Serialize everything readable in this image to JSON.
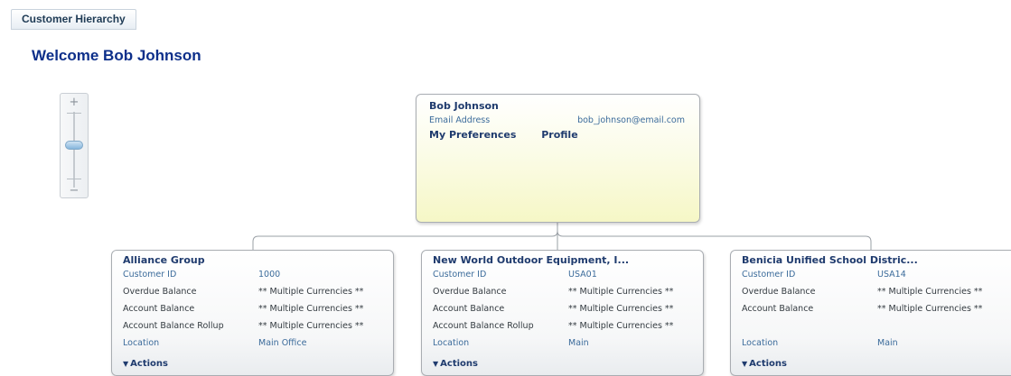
{
  "tab": {
    "label": "Customer Hierarchy"
  },
  "welcome": "Welcome Bob Johnson",
  "zoom": {
    "plus": "+",
    "minus": "−"
  },
  "root": {
    "name": "Bob Johnson",
    "email_label": "Email Address",
    "email_value": "bob_johnson@email.com",
    "links": [
      "My Preferences",
      "Profile"
    ]
  },
  "children": [
    {
      "title": "Alliance Group",
      "rows": [
        {
          "label": "Customer ID",
          "value": "1000"
        },
        {
          "label": "Overdue Balance",
          "value": "** Multiple Currencies **"
        },
        {
          "label": "Account Balance",
          "value": "** Multiple Currencies **"
        },
        {
          "label": "Account Balance Rollup",
          "value": "** Multiple Currencies **"
        },
        {
          "label": "Location",
          "value": "Main Office"
        }
      ],
      "actions": "Actions"
    },
    {
      "title": "New World Outdoor Equipment, I...",
      "rows": [
        {
          "label": "Customer ID",
          "value": "USA01"
        },
        {
          "label": "Overdue Balance",
          "value": "** Multiple Currencies **"
        },
        {
          "label": "Account Balance",
          "value": "** Multiple Currencies **"
        },
        {
          "label": "Account Balance Rollup",
          "value": "** Multiple Currencies **"
        },
        {
          "label": "Location",
          "value": "Main"
        }
      ],
      "actions": "Actions"
    },
    {
      "title": "Benicia Unified School Distric...",
      "rows": [
        {
          "label": "Customer ID",
          "value": "USA14"
        },
        {
          "label": "Overdue Balance",
          "value": "** Multiple Currencies **"
        },
        {
          "label": "Account Balance",
          "value": "** Multiple Currencies **"
        },
        {
          "label": "",
          "value": ""
        },
        {
          "label": "Location",
          "value": "Main"
        }
      ],
      "actions": "Actions"
    }
  ]
}
